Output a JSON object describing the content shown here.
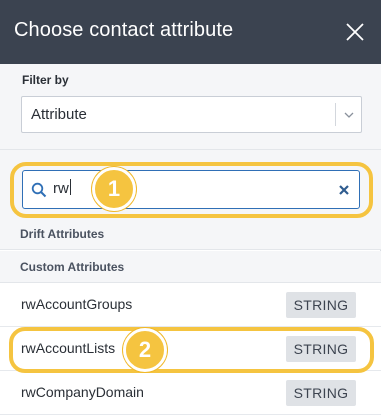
{
  "header": {
    "title": "Choose contact attribute",
    "close_icon": "close-icon"
  },
  "filter": {
    "label": "Filter by",
    "selected": "Attribute",
    "chevron_icon": "chevron-down-icon"
  },
  "search": {
    "value": "rw",
    "search_icon": "search-icon",
    "clear_icon": "clear-icon"
  },
  "annotations": {
    "step1": "1",
    "step2": "2",
    "ring_color": "#f5c440"
  },
  "groups": {
    "drift": "Drift Attributes",
    "custom": "Custom Attributes"
  },
  "attributes": [
    {
      "name": "rwAccountGroups",
      "type": "STRING"
    },
    {
      "name": "rwAccountLists",
      "type": "STRING"
    },
    {
      "name": "rwCompanyDomain",
      "type": "STRING"
    }
  ],
  "colors": {
    "header_bg": "#3b4350",
    "search_border": "#2f6fb6",
    "badge_bg": "#dfe2e6"
  }
}
